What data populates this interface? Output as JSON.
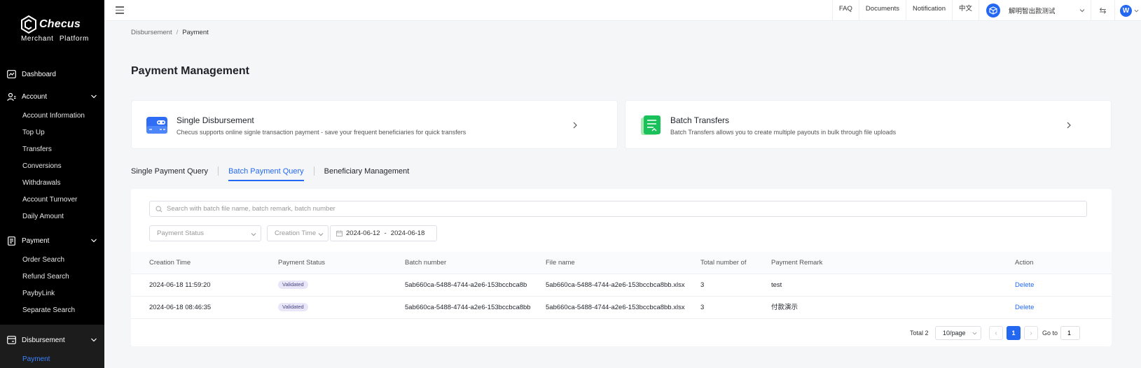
{
  "sidebar": {
    "logo_name": "Checus",
    "logo_sub": "Merchant Platform",
    "dashboard": "Dashboard",
    "account": {
      "label": "Account",
      "items": [
        "Account Information",
        "Top Up",
        "Transfers",
        "Conversions",
        "Withdrawals",
        "Account Turnover",
        "Daily Amount"
      ]
    },
    "payment": {
      "label": "Payment",
      "items": [
        "Order Search",
        "Refund Search",
        "PaybyLink",
        "Separate Search"
      ]
    },
    "disbursement": {
      "label": "Disbursement",
      "items": [
        "Payment"
      ]
    }
  },
  "topbar": {
    "links": [
      "FAQ",
      "Documents",
      "Notification",
      "中文"
    ],
    "merchant_name": "解明智出款测试",
    "avatar_letter": "W"
  },
  "breadcrumb": {
    "parent": "Disbursement",
    "separator": "/",
    "current": "Payment"
  },
  "page_title": "Payment Management",
  "cards": {
    "single": {
      "title": "Single Disbursement",
      "desc": "Checus supports online signle transaction payment - save your frequent beneficiaries for quick transfers"
    },
    "batch": {
      "title": "Batch Transfers",
      "desc": "Batch Transfers allows you to create multiple payouts in bulk through file uploads"
    }
  },
  "tabs": [
    "Single Payment Query",
    "Batch Payment Query",
    "Beneficiary Management"
  ],
  "filters": {
    "search_placeholder": "Search with batch file name, batch remark, batch number",
    "payment_status_placeholder": "Payment Status",
    "creation_time_label": "Creation Time",
    "date_from": "2024-06-12",
    "date_sep": "-",
    "date_to": "2024-06-18"
  },
  "table": {
    "headers": [
      "Creation Time",
      "Payment Status",
      "Batch number",
      "File name",
      "Total number of",
      "Payment Remark",
      "Action"
    ],
    "rows": [
      [
        "2024-06-18 11:59:20",
        "Validated",
        "5ab660ca-5488-4744-a2e6-153bccbca8b",
        "5ab660ca-5488-4744-a2e6-153bccbca8bb.xlsx",
        "3",
        "test",
        "Delete"
      ],
      [
        "2024-06-18 08:46:35",
        "Validated",
        "5ab660ca-5488-4744-a2e6-153bccbca8bb",
        "5ab660ca-5488-4744-a2e6-153bccbca8bb.xlsx",
        "3",
        "付款演示",
        "Delete"
      ]
    ]
  },
  "pagination": {
    "total": "Total 2",
    "page_size": "10/page",
    "prev": "‹",
    "current": "1",
    "next": "›",
    "goto_label": "Go to",
    "goto_value": "1"
  },
  "colors": {
    "accent": "#2468f2",
    "sidebar_bg": "#000000",
    "active_nav": "#3b82ff",
    "badge_bg": "#e8e6f8"
  }
}
